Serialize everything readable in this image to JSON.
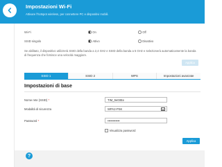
{
  "header": {
    "title": "Impostazioni Wi-Fi",
    "subtitle": "Attivare l'hotspot wireless, per connettere PC e dispositivi mobili."
  },
  "wifi": {
    "label": "Wi-Fi",
    "options": [
      "On",
      "Off"
    ],
    "selected": "On"
  },
  "ssid_merge": {
    "label": "SSID singolo",
    "options": [
      "Attivo",
      "Disattivo"
    ],
    "selected": "Attivo"
  },
  "description": "Se abilitato, il dispositivo utilizzerà SSID della banda a 2,4 GHz e SSID della banda a 5 GHz e selezionerà automaticamente la banda di frequenza che fornisce una velocità maggiore.",
  "apply_top_label": "Applica",
  "tabs": [
    {
      "label": "SSID 1",
      "active": true
    },
    {
      "label": "SSID 2",
      "active": false
    },
    {
      "label": "WPS",
      "active": false
    },
    {
      "label": "Impostazioni avanzate",
      "active": false
    }
  ],
  "section_title": "Impostazioni di base",
  "form": {
    "ssid_label": "Nome rete (SSID)",
    "ssid_value": "TIM_9e03Ee",
    "security_label": "Modalità di sicurezza",
    "security_value": "WPA2-PSK",
    "password_label": "Password",
    "password_value": "••••••••••••",
    "show_password_label": "Visualizza password",
    "required_mark": "*"
  },
  "apply_bottom_label": "Applica",
  "help_glyph": "?",
  "colors": {
    "accent": "#1a9bd7",
    "button_disabled": "#cfe6f3",
    "required": "#e53935"
  },
  "icons": {
    "back": "chevron-left-icon",
    "dropdown": "chevron-down-icon",
    "help": "help-icon"
  }
}
